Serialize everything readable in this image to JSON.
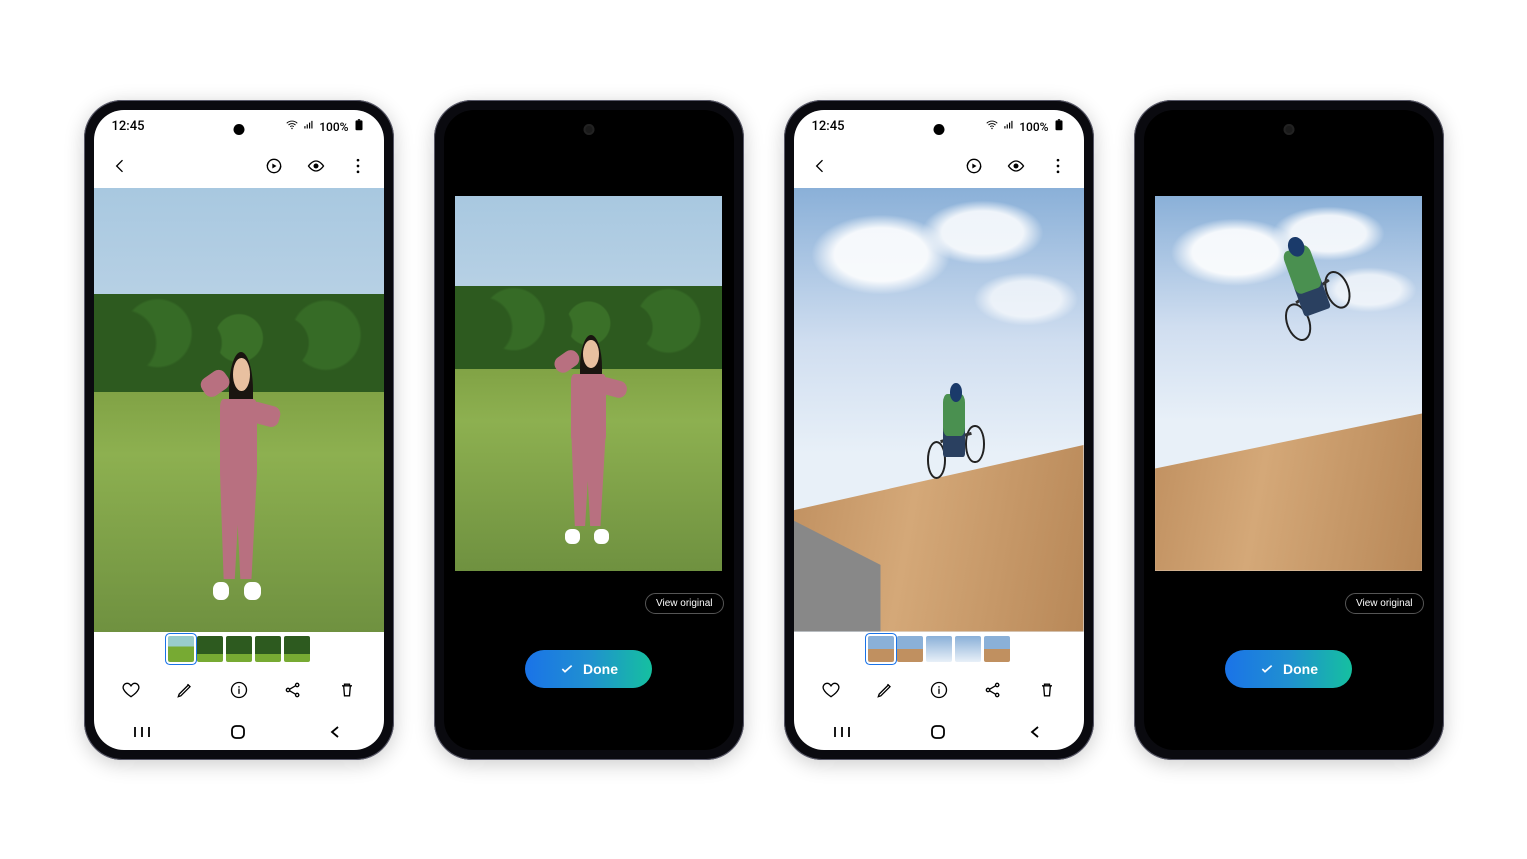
{
  "status": {
    "time": "12:45",
    "battery_text": "100%"
  },
  "buttons": {
    "done": "Done",
    "view_original": "View original"
  },
  "icons": {
    "back": "back-icon",
    "remaster": "remaster-icon",
    "eye": "eye-icon",
    "more": "more-icon",
    "favorite": "heart-icon",
    "edit": "pencil-icon",
    "info": "info-icon",
    "share": "share-icon",
    "delete": "trash-icon",
    "recents": "recents-icon",
    "home": "home-icon",
    "navback": "nav-back-icon",
    "check": "check-icon",
    "wifi": "wifi-icon",
    "signal": "signal-icon",
    "battery": "battery-icon"
  },
  "phones": [
    {
      "mode": "light",
      "scene": "park",
      "thumbs": [
        "park-t sel",
        "tree-t",
        "tree-t",
        "tree-t",
        "tree-t"
      ]
    },
    {
      "mode": "dark",
      "scene": "park"
    },
    {
      "mode": "light",
      "scene": "bmx-low",
      "thumbs": [
        "ramp-t sel",
        "ramp-t",
        "sky-t",
        "sky-t",
        "ramp-t"
      ]
    },
    {
      "mode": "dark",
      "scene": "bmx-high"
    }
  ]
}
